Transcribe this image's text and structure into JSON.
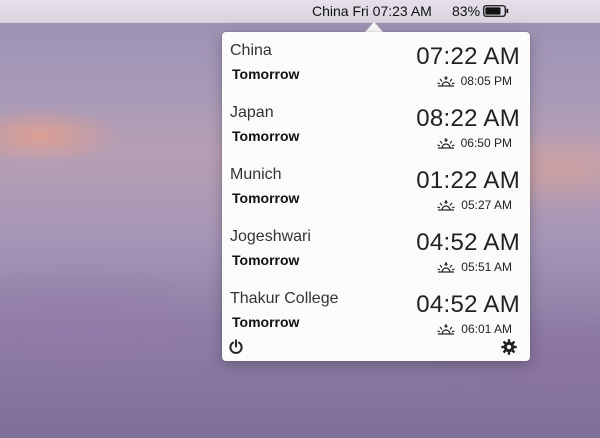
{
  "menubar": {
    "clock": "China Fri 07:23 AM",
    "battery_percent": "83%",
    "battery_level": 0.83
  },
  "clocks": [
    {
      "city": "China",
      "day": "Tomorrow",
      "time": "07:22 AM",
      "sun_event": "sunset",
      "sun_time": "08:05 PM"
    },
    {
      "city": "Japan",
      "day": "Tomorrow",
      "time": "08:22 AM",
      "sun_event": "sunset",
      "sun_time": "06:50 PM"
    },
    {
      "city": "Munich",
      "day": "Tomorrow",
      "time": "01:22 AM",
      "sun_event": "sunrise",
      "sun_time": "05:27 AM"
    },
    {
      "city": "Jogeshwari",
      "day": "Tomorrow",
      "time": "04:52 AM",
      "sun_event": "sunrise",
      "sun_time": "05:51 AM"
    },
    {
      "city": "Thakur College",
      "day": "Tomorrow",
      "time": "04:52 AM",
      "sun_event": "sunrise",
      "sun_time": "06:01 AM"
    }
  ],
  "footer": {
    "left_icon": "power-icon",
    "right_icon": "gear-icon"
  }
}
